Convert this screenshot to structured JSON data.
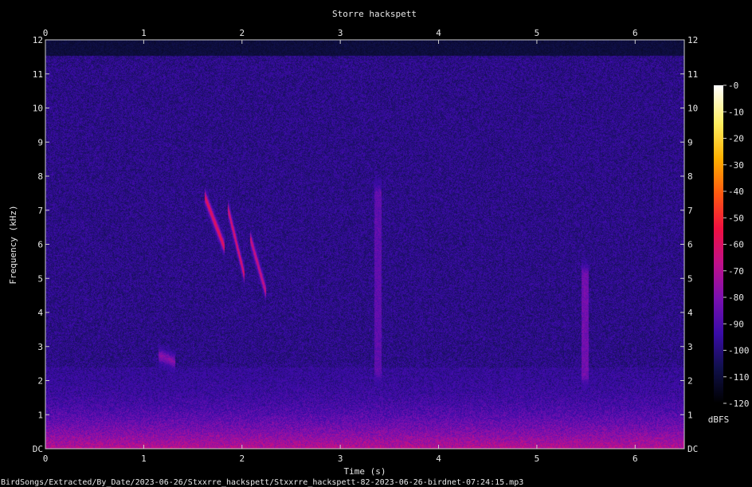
{
  "chart_data": {
    "type": "heatmap",
    "title": "Storre hackspett",
    "xlabel": "Time (s)",
    "ylabel": "Frequency (kHz)",
    "xlim": [
      0,
      6.5
    ],
    "ylim": [
      0,
      12
    ],
    "x_ticks": [
      "0",
      "1",
      "2",
      "3",
      "4",
      "5",
      "6"
    ],
    "y_ticks": [
      "DC",
      "1",
      "2",
      "3",
      "4",
      "5",
      "6",
      "7",
      "8",
      "9",
      "10",
      "11",
      "12"
    ],
    "colorbar": {
      "label": "dBFS",
      "range": [
        -120,
        0
      ],
      "ticks": [
        "-0",
        "-10",
        "-20",
        "-30",
        "-40",
        "-50",
        "-60",
        "-70",
        "-80",
        "-90",
        "-100",
        "-110",
        "-120"
      ],
      "colors": [
        "#000000",
        "#10104a",
        "#3a0ca8",
        "#7a10b0",
        "#c0108a",
        "#f01040",
        "#ff5a10",
        "#ffb000",
        "#ffee60",
        "#ffffff"
      ]
    },
    "background_level_dbfs": -98,
    "low_frequency_band": {
      "freq_khz": [
        0,
        2.4
      ],
      "peak_level_dbfs": -68
    },
    "events": [
      {
        "start_s": 1.62,
        "end_s": 1.82,
        "freq_high_khz": 7.4,
        "freq_low_khz": 5.9,
        "peak_level_dbfs": -58
      },
      {
        "start_s": 1.85,
        "end_s": 2.02,
        "freq_high_khz": 7.1,
        "freq_low_khz": 5.1,
        "peak_level_dbfs": -60
      },
      {
        "start_s": 2.08,
        "end_s": 2.24,
        "freq_high_khz": 6.2,
        "freq_low_khz": 4.6,
        "peak_level_dbfs": -64
      },
      {
        "start_s": 3.34,
        "end_s": 3.42,
        "freq_high_khz": 7.5,
        "freq_low_khz": 2.3,
        "peak_level_dbfs": -86
      },
      {
        "start_s": 5.45,
        "end_s": 5.52,
        "freq_high_khz": 5.1,
        "freq_low_khz": 2.2,
        "peak_level_dbfs": -82
      },
      {
        "start_s": 1.15,
        "end_s": 1.32,
        "freq_high_khz": 2.75,
        "freq_low_khz": 2.55,
        "peak_level_dbfs": -78
      }
    ]
  },
  "footer": {
    "filepath": "BirdSongs/Extracted/By_Date/2023-06-26/Stxxrre_hackspett/Stxxrre_hackspett-82-2023-06-26-birdnet-07:24:15.mp3"
  }
}
